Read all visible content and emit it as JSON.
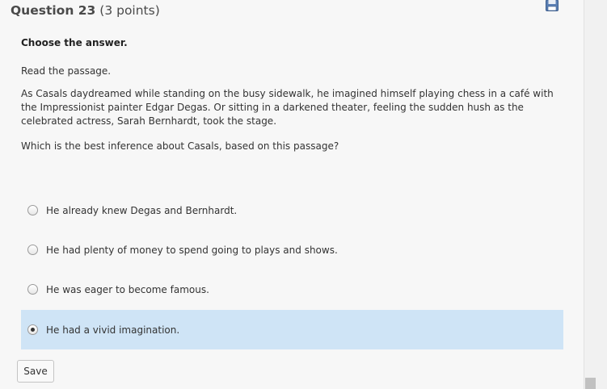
{
  "question": {
    "title": "Question 23",
    "points": "(3 points)"
  },
  "prompt": "Choose the answer.",
  "instructions": "Read the passage.",
  "passage": "As Casals daydreamed while standing on the busy sidewalk, he imagined himself playing chess in a café with the Impressionist painter Edgar Degas. Or sitting in a darkened theater, feeling the sudden hush as the celebrated actress, Sarah Bernhardt, took the stage.",
  "question_text": "Which is the best inference about Casals, based on this passage?",
  "choices": [
    {
      "label": "He already knew Degas and Bernhardt.",
      "selected": false
    },
    {
      "label": "He had plenty of money to spend going to plays and shows.",
      "selected": false
    },
    {
      "label": "He was eager to become famous.",
      "selected": false
    },
    {
      "label": "He had a vivid imagination.",
      "selected": true
    }
  ],
  "save_label": "Save",
  "icons": {
    "save": "floppy-disk-icon"
  },
  "colors": {
    "selected_bg": "#cfe4f6",
    "background": "#f7f7f7"
  }
}
